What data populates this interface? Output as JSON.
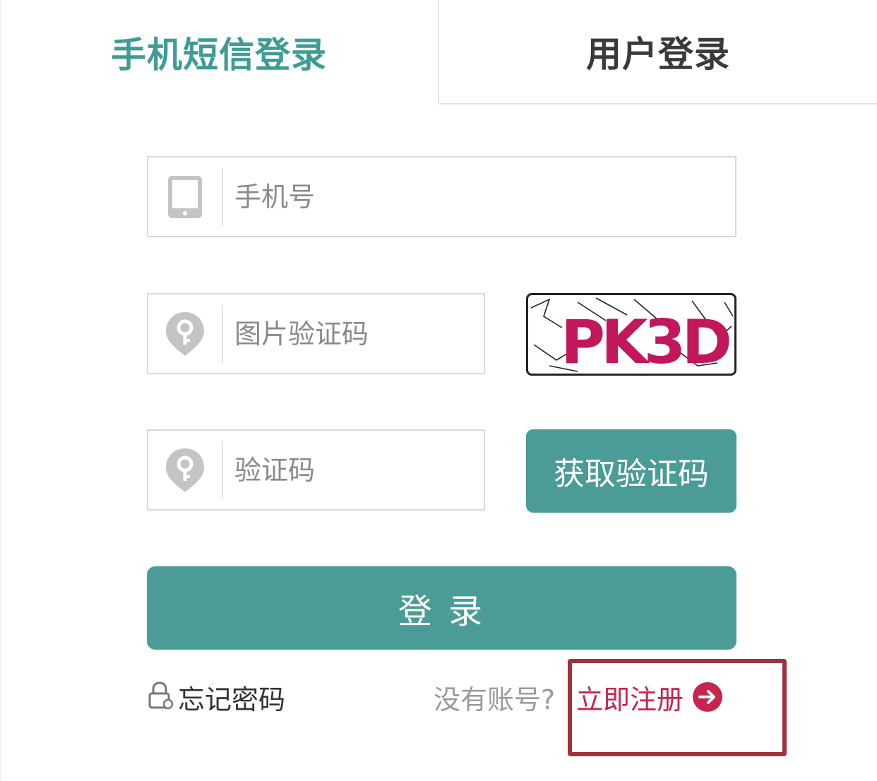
{
  "tabs": {
    "sms_login": "手机短信登录",
    "user_login": "用户登录"
  },
  "form": {
    "phone_placeholder": "手机号",
    "image_code_placeholder": "图片验证码",
    "sms_code_placeholder": "验证码",
    "captcha_text": "PK3D",
    "get_code_label": "获取验证码",
    "login_label": "登 录"
  },
  "footer": {
    "forgot_label": "忘记密码",
    "no_account_text": "没有账号?",
    "register_label": "立即注册"
  },
  "icons": {
    "phone": "mobile-phone-icon",
    "image_code": "key-pin-icon",
    "sms_code": "key-pin-icon",
    "forgot": "lock-icon",
    "register": "arrow-right-circle-icon"
  },
  "colors": {
    "accent": "#4b9b96",
    "tab_active": "#3e9c95",
    "register": "#c7254e",
    "highlight": "#a0323c"
  }
}
